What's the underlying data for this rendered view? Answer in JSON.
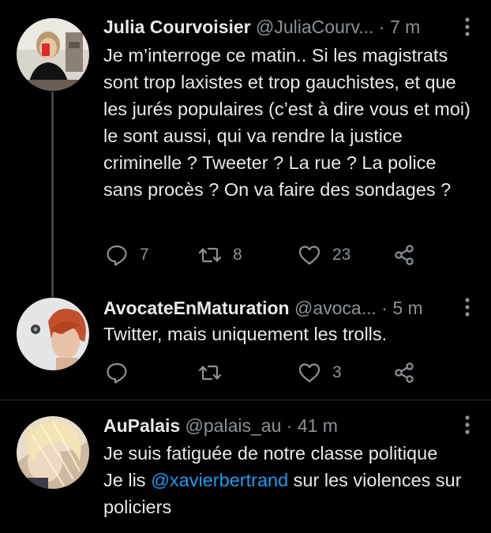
{
  "colors": {
    "background": "#000000",
    "text": "#e7e9ea",
    "muted": "#8b9298",
    "mention": "#1d9bf0",
    "divider": "#2f3336"
  },
  "tweets": [
    {
      "name": "Julia Courvoisier",
      "handle": "@JuliaCourv...",
      "separator": "·",
      "time": "7 m",
      "text": "Je m’interroge ce matin.. Si les magistrats sont trop laxistes et trop gauchistes, et que les jurés populaires (c’est à dire vous et moi) le sont aussi, qui va rendre la justice criminelle ? Tweeter ? La rue ? La police sans procès ? On va faire des sondages ?",
      "replies": "7",
      "retweets": "8",
      "likes": "23",
      "icons": [
        "reply-icon",
        "retweet-icon",
        "like-icon",
        "share-icon",
        "more-icon"
      ]
    },
    {
      "name": "AvocateEnMaturation",
      "handle": "@avoca...",
      "separator": "·",
      "time": "5 m",
      "text": "Twitter, mais uniquement les trolls.",
      "replies": "",
      "retweets": "",
      "likes": "3",
      "icons": [
        "reply-icon",
        "retweet-icon",
        "like-icon",
        "share-icon",
        "more-icon"
      ]
    },
    {
      "name": "AuPalais",
      "handle": "@palais_au",
      "separator": "·",
      "time": "41 m",
      "text_line_1": "Je suis fatiguée de notre classe politique",
      "text_line_2_prefix": "Je lis ",
      "mention": "@xavierbertrand",
      "text_line_2_suffix": " sur les violences sur policiers",
      "icons": [
        "more-icon"
      ]
    }
  ]
}
